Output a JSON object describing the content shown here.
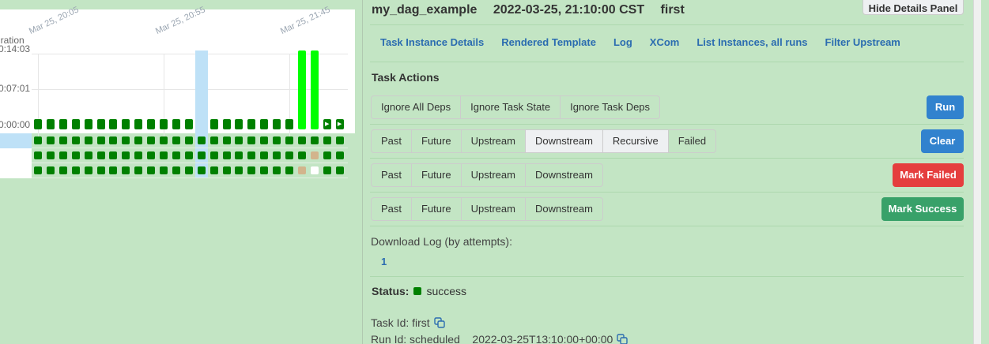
{
  "grid": {
    "y_axis_title": "uration",
    "y_ticks": [
      "0:14:03",
      "0:07:01",
      "0:00:00"
    ],
    "x_ticks": [
      "Mar 25, 20:05",
      "Mar 25, 20:55",
      "Mar 25, 21:45"
    ],
    "play_symbol": "▶"
  },
  "details": {
    "dag_id": "my_dag_example",
    "run_time": "2022-03-25, 21:10:00 CST",
    "task_id": "first",
    "hide_button": "Hide Details Panel",
    "tabs": [
      "Task Instance Details",
      "Rendered Template",
      "Log",
      "XCom",
      "List Instances, all runs",
      "Filter Upstream"
    ],
    "actions_title": "Task Actions",
    "run_group": [
      "Ignore All Deps",
      "Ignore Task State",
      "Ignore Task Deps"
    ],
    "run_label": "Run",
    "clear_group": [
      "Past",
      "Future",
      "Upstream",
      "Downstream",
      "Recursive",
      "Failed"
    ],
    "clear_label": "Clear",
    "failed_group": [
      "Past",
      "Future",
      "Upstream",
      "Downstream"
    ],
    "mark_failed_label": "Mark Failed",
    "success_group": [
      "Past",
      "Future",
      "Upstream",
      "Downstream"
    ],
    "mark_success_label": "Mark Success",
    "download_log_label": "Download Log (by attempts):",
    "attempt": "1",
    "status_label": "Status:",
    "status_value": "success",
    "status_color": "#008000",
    "task_id_line": "Task Id: first",
    "run_id_line": "Run Id: scheduled__2022-03-25T13:10:00+00:00"
  }
}
